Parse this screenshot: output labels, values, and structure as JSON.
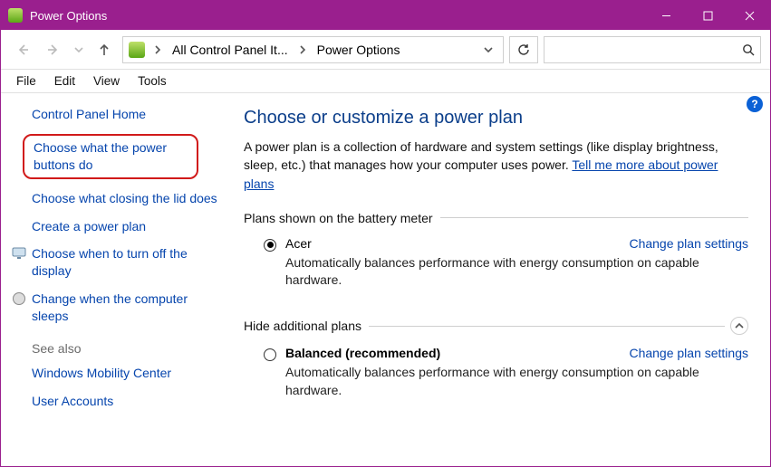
{
  "window": {
    "title": "Power Options"
  },
  "breadcrumb": {
    "items": [
      "All Control Panel It...",
      "Power Options"
    ]
  },
  "search": {
    "placeholder": ""
  },
  "menus": {
    "file": "File",
    "edit": "Edit",
    "view": "View",
    "tools": "Tools"
  },
  "sidebar": {
    "home": "Control Panel Home",
    "links": [
      "Choose what the power buttons do",
      "Choose what closing the lid does",
      "Create a power plan",
      "Choose when to turn off the display",
      "Change when the computer sleeps"
    ],
    "see_also_label": "See also",
    "see_also": [
      "Windows Mobility Center",
      "User Accounts"
    ]
  },
  "main": {
    "heading": "Choose or customize a power plan",
    "intro_a": "A power plan is a collection of hardware and system settings (like display brightness, sleep, etc.) that manages how your computer uses power. ",
    "intro_link": "Tell me more about power plans",
    "section1_title": "Plans shown on the battery meter",
    "plan1": {
      "name": "Acer",
      "change": "Change plan settings",
      "desc": "Automatically balances performance with energy consumption on capable hardware."
    },
    "section2_title": "Hide additional plans",
    "plan2": {
      "name": "Balanced (recommended)",
      "change": "Change plan settings",
      "desc": "Automatically balances performance with energy consumption on capable hardware."
    },
    "help_char": "?"
  }
}
